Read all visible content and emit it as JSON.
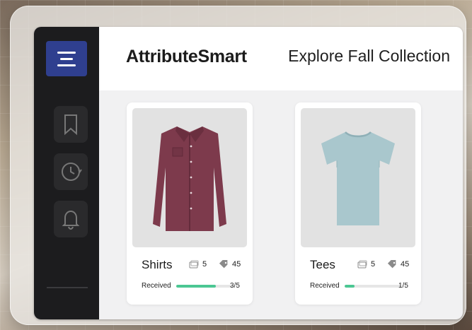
{
  "app": {
    "brand": "AttributeSmart",
    "title": "Explore Fall Collection"
  },
  "sidebar": {
    "menu_icon": "hamburger-menu-icon",
    "items": [
      {
        "icon": "bookmark-icon"
      },
      {
        "icon": "history-clock-icon"
      },
      {
        "icon": "bell-icon"
      }
    ]
  },
  "products": [
    {
      "name": "Shirts",
      "image_icon": "shirt-icon",
      "image_count": "5",
      "tag_count": "45",
      "received_label": "Received",
      "received_text": "3/5",
      "received_fraction": 0.6,
      "color": "#7d3a4c"
    },
    {
      "name": "Tees",
      "image_icon": "tshirt-icon",
      "image_count": "5",
      "tag_count": "45",
      "received_label": "Received",
      "received_text": "1/5",
      "received_fraction": 0.2,
      "color": "#a9c7cd"
    }
  ],
  "colors": {
    "accent": "#2f3f8f",
    "progress": "#4cc793",
    "sidebar": "#1c1c1e"
  }
}
